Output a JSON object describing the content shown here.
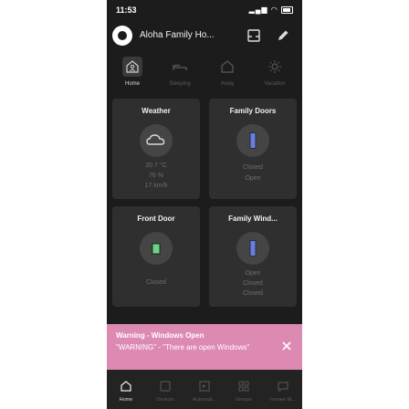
{
  "status_bar": {
    "time": "11:53"
  },
  "header": {
    "title": "Aloha Family Ho..."
  },
  "tabs": [
    {
      "label": "Home",
      "icon": "home-icon",
      "active": true
    },
    {
      "label": "Sleeping",
      "icon": "bed-icon",
      "active": false
    },
    {
      "label": "Away",
      "icon": "away-house-icon",
      "active": false
    },
    {
      "label": "Vacation",
      "icon": "sun-icon",
      "active": false
    }
  ],
  "cards": [
    {
      "title": "Weather",
      "icon": "cloud-icon",
      "lines": [
        "20.7 °C",
        "76 %",
        "17 km/h"
      ]
    },
    {
      "title": "Family Doors",
      "icon": "door-icon",
      "lines": [
        "Closed",
        "Open"
      ]
    },
    {
      "title": "Front Door",
      "icon": "door-icon",
      "lines": [
        "Closed"
      ]
    },
    {
      "title": "Family Wind...",
      "icon": "window-icon",
      "lines": [
        "Open",
        "Closed",
        "Closed"
      ]
    }
  ],
  "toast": {
    "title": "Warning - Windows Open",
    "message": "\"WARNING\" - \"There are open Windows\"",
    "color": "#dd8ab3"
  },
  "bottom_nav": [
    {
      "label": "Home",
      "icon": "home-icon",
      "active": true
    },
    {
      "label": "Devices",
      "icon": "devices-icon",
      "active": false
    },
    {
      "label": "Automati...",
      "icon": "automation-icon",
      "active": false
    },
    {
      "label": "Groups",
      "icon": "groups-icon",
      "active": false
    },
    {
      "label": "homee W...",
      "icon": "homee-icon",
      "active": false
    }
  ],
  "colors": {
    "background": "#1c1c1c",
    "card": "#2f2f2f",
    "toast": "#dd8ab3",
    "accent_blue": "#6a7fd6",
    "accent_green": "#6fd08a"
  }
}
